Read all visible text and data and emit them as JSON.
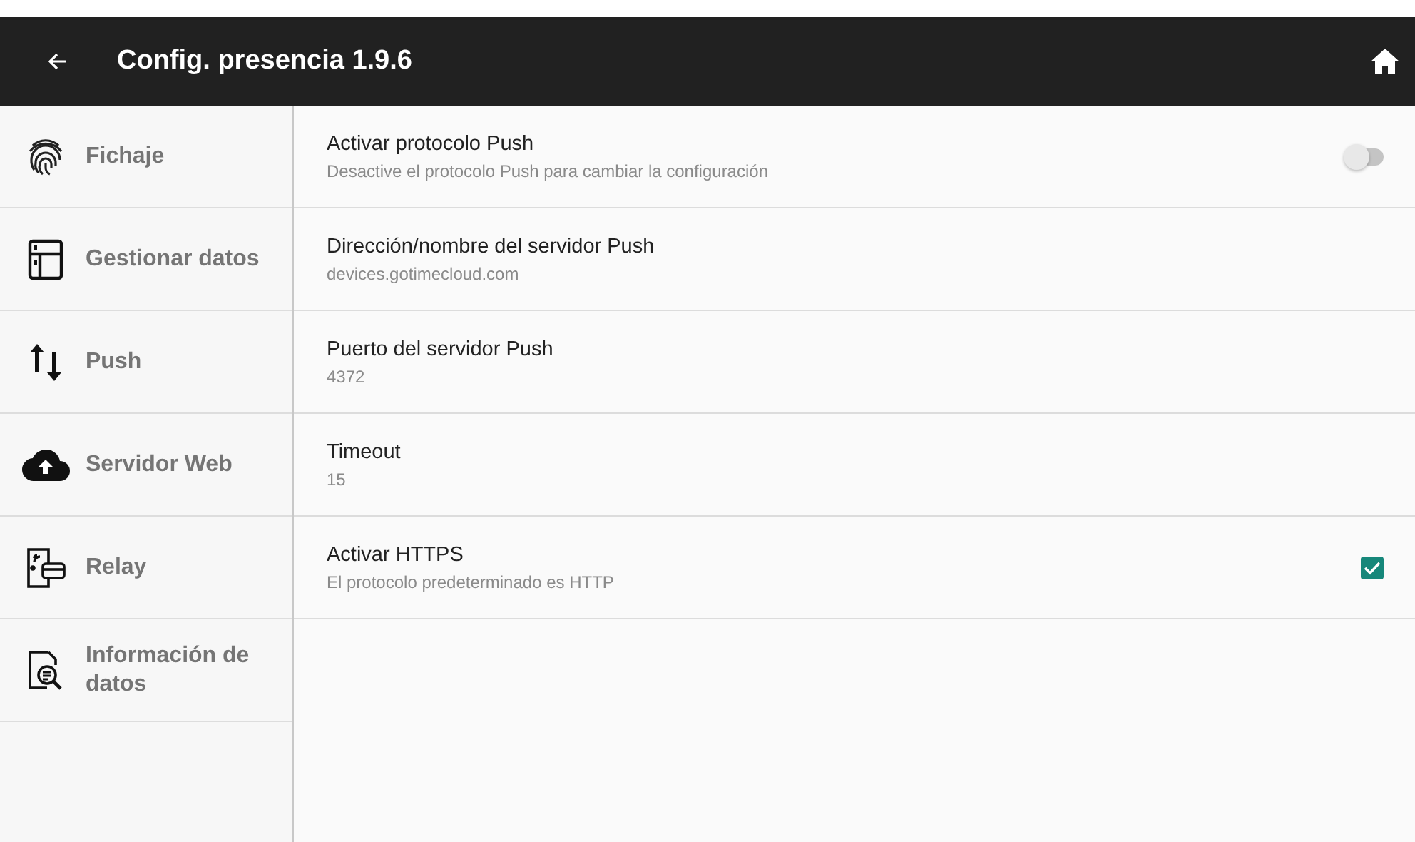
{
  "app_bar": {
    "title": "Config. presencia 1.9.6"
  },
  "sidebar": {
    "items": [
      {
        "label": "Fichaje",
        "selected": false
      },
      {
        "label": "Gestionar datos",
        "selected": false
      },
      {
        "label": "Push",
        "selected": false
      },
      {
        "label": "Servidor Web",
        "selected": false
      },
      {
        "label": "Relay",
        "selected": false
      },
      {
        "label": "Información de datos",
        "selected": false
      }
    ]
  },
  "settings": [
    {
      "kind": "switch",
      "title": "Activar protocolo Push",
      "summary": "Desactive el protocolo Push para cambiar la configuración",
      "on": false
    },
    {
      "kind": "text",
      "title": "Dirección/nombre del servidor Push",
      "summary": "devices.gotimecloud.com"
    },
    {
      "kind": "text",
      "title": "Puerto del servidor Push",
      "summary": "4372"
    },
    {
      "kind": "text",
      "title": "Timeout",
      "summary": "15"
    },
    {
      "kind": "checkbox",
      "title": "Activar HTTPS",
      "summary": "El protocolo predeterminado es HTTP",
      "checked": true
    }
  ]
}
